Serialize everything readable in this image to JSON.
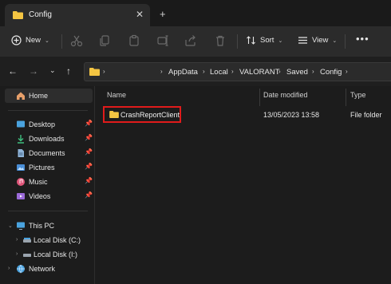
{
  "window": {
    "tab_title": "Config",
    "tab_close": "✕",
    "new_tab": "+"
  },
  "toolbar": {
    "new_label": "New",
    "sort_label": "Sort",
    "view_label": "View",
    "more": "•••"
  },
  "address": {
    "crumbs": [
      "AppData",
      "Local",
      "VALORANT",
      "Saved",
      "Config"
    ]
  },
  "sidebar": {
    "home": "Home",
    "quick_access": [
      {
        "label": "Desktop",
        "icon": "desktop-icon"
      },
      {
        "label": "Downloads",
        "icon": "downloads-icon"
      },
      {
        "label": "Documents",
        "icon": "documents-icon"
      },
      {
        "label": "Pictures",
        "icon": "pictures-icon"
      },
      {
        "label": "Music",
        "icon": "music-icon"
      },
      {
        "label": "Videos",
        "icon": "videos-icon"
      }
    ],
    "this_pc": "This PC",
    "drives": [
      "Local Disk (C:)",
      "Local Disk (I:)"
    ],
    "network": "Network"
  },
  "columns": {
    "name": "Name",
    "date_modified": "Date modified",
    "type": "Type"
  },
  "files": [
    {
      "name": "CrashReportClient",
      "date_modified": "13/05/2023 13:58",
      "type": "File folder"
    }
  ],
  "colors": {
    "folder": "#f4c542",
    "highlight": "#e01b1b",
    "background": "#1c1c1c"
  }
}
